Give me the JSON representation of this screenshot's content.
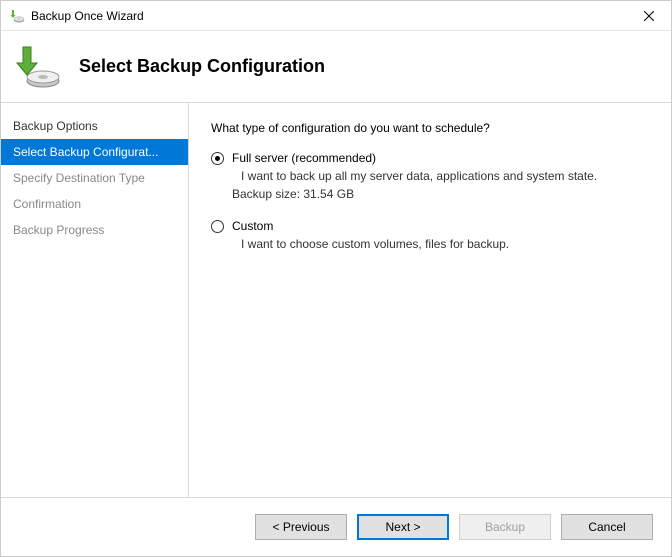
{
  "window": {
    "title": "Backup Once Wizard"
  },
  "header": {
    "title": "Select Backup Configuration"
  },
  "sidebar": {
    "steps": [
      {
        "label": "Backup Options",
        "state": "done"
      },
      {
        "label": "Select Backup Configurat...",
        "state": "current"
      },
      {
        "label": "Specify Destination Type",
        "state": "future"
      },
      {
        "label": "Confirmation",
        "state": "future"
      },
      {
        "label": "Backup Progress",
        "state": "future"
      }
    ]
  },
  "content": {
    "prompt": "What type of configuration do you want to schedule?",
    "options": [
      {
        "label": "Full server (recommended)",
        "desc": "I want to back up all my server data, applications and system state.",
        "extra": "Backup size: 31.54 GB",
        "selected": true
      },
      {
        "label": "Custom",
        "desc": "I want to choose custom volumes, files for backup.",
        "extra": "",
        "selected": false
      }
    ]
  },
  "footer": {
    "previous": "< Previous",
    "next": "Next >",
    "backup": "Backup",
    "cancel": "Cancel"
  }
}
